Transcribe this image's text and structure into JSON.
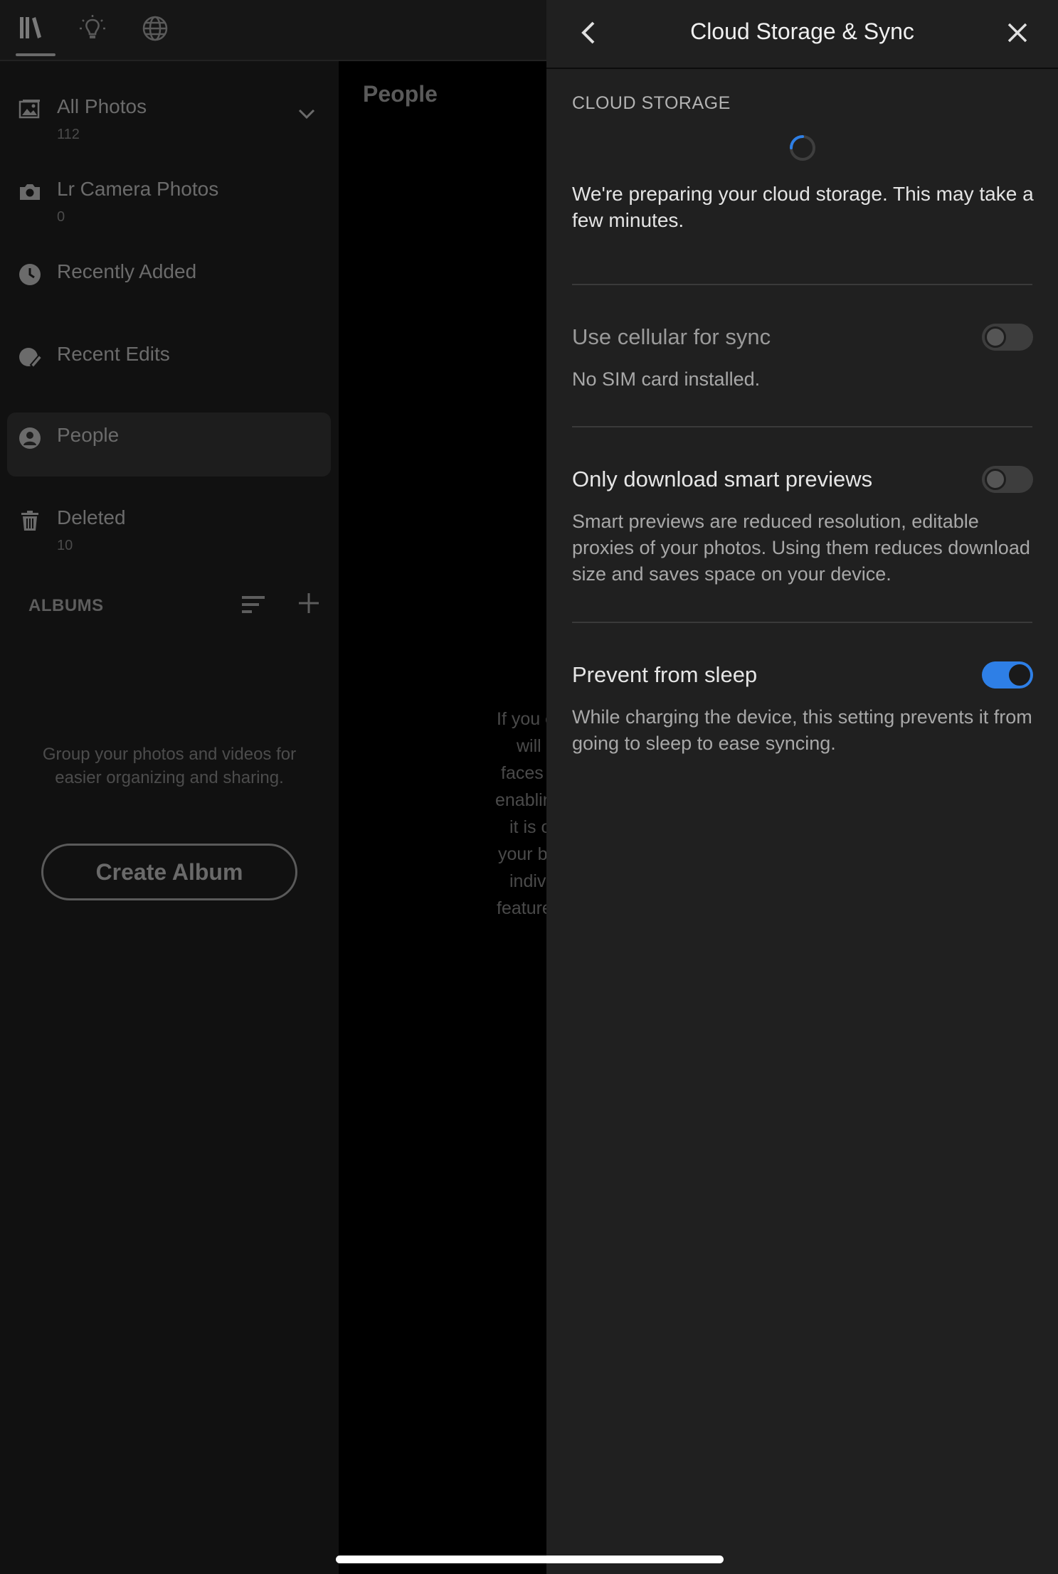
{
  "sidebar": {
    "items": [
      {
        "label": "All Photos",
        "count": "112",
        "icon": "image-icon"
      },
      {
        "label": "Lr Camera Photos",
        "count": "0",
        "icon": "camera-icon"
      },
      {
        "label": "Recently Added",
        "count": "",
        "icon": "clock-icon"
      },
      {
        "label": "Recent Edits",
        "count": "",
        "icon": "edit-icon"
      },
      {
        "label": "People",
        "count": "",
        "icon": "person-icon",
        "selected": true
      },
      {
        "label": "Deleted",
        "count": "10",
        "icon": "trash-icon"
      }
    ],
    "albums": {
      "header": "ALBUMS",
      "empty_text": "Group your photos and videos for easier organizing and sharing.",
      "create_button": "Create Album"
    }
  },
  "middle": {
    "title": "People",
    "text_lines": [
      "If you e",
      "will a",
      "faces i",
      "enablin",
      "it is o",
      "your b",
      "indivi",
      "feature"
    ]
  },
  "panel": {
    "title": "Cloud Storage & Sync",
    "cloud_storage": {
      "label": "CLOUD STORAGE",
      "message": "We're preparing your cloud storage. This may take a few minutes."
    },
    "settings": [
      {
        "title": "Use cellular for sync",
        "description": "No SIM card installed.",
        "enabled": false,
        "disabled": true
      },
      {
        "title": "Only download smart previews",
        "description": "Smart previews are reduced resolution, editable proxies of your photos. Using them reduces download size and saves space on your device.",
        "enabled": false,
        "disabled": false
      },
      {
        "title": "Prevent from sleep",
        "description": "While charging the device, this setting prevents it from going to sleep to ease syncing.",
        "enabled": true,
        "disabled": false
      }
    ]
  },
  "colors": {
    "accent": "#2e7fe6",
    "panel_bg": "#202020",
    "sidebar_bg": "#111111"
  }
}
